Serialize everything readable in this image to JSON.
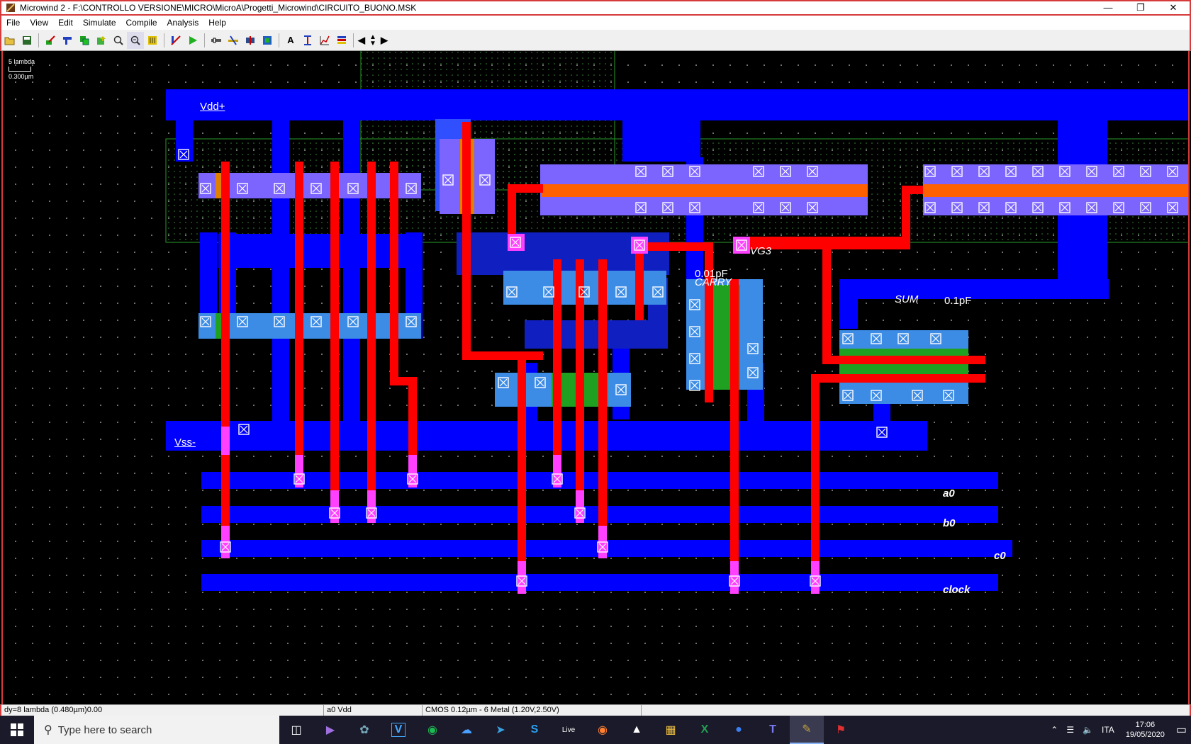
{
  "window": {
    "title": "Microwind 2 - F:\\CONTROLLO VERSIONE\\MICRO\\MicroA\\Progetti_Microwind\\CIRCUITO_BUONO.MSK"
  },
  "menu": [
    "File",
    "View",
    "Edit",
    "Simulate",
    "Compile",
    "Analysis",
    "Help"
  ],
  "toolbar": {
    "icons": [
      "open-icon",
      "save-icon",
      "draw-box-icon",
      "properties-icon",
      "duplicate-icon",
      "move-icon",
      "zoom-in-icon",
      "zoom-out-icon",
      "view-all-icon",
      "process-icon",
      "run-simulation-icon",
      "connect-icon",
      "cut-icon",
      "mos-generator-icon",
      "compile-icon",
      "text-icon",
      "vertical-stretch-icon",
      "graph-icon",
      "layers-icon",
      "arrow-left-icon",
      "arrow-up-down-icon",
      "arrow-right-icon"
    ],
    "text_button": "A"
  },
  "scale": {
    "lambda": "5 lambda",
    "micron": "0.300µm"
  },
  "labels": {
    "vdd": "Vdd+",
    "vss": "Vss-",
    "vg3": "VG3",
    "carry": "CARRY",
    "cap1": "0.01pF",
    "sum": "SUM",
    "cap2": "0.1pF",
    "a0": "a0",
    "b0": "b0",
    "c0": "c0",
    "clock": "clock"
  },
  "colors": {
    "metal1": "#0000ff",
    "diffusion": "#3c8ce6",
    "pdiff": "#7c64ff",
    "poly": "#ff0000",
    "contact_poly": "#ff40ff",
    "nwell": "#1a9a1a",
    "titlebar_border": "#d63a3a"
  },
  "status": {
    "coords": "dy=8 lambda (0.480µm)0.00",
    "node": "a0 Vdd",
    "process": "CMOS 0.12µm - 6 Metal (1.20V,2.50V)"
  },
  "taskbar": {
    "search_placeholder": "Type here to search",
    "apps": [
      "task-view-icon",
      "visual-studio-icon",
      "davinci-icon",
      "vivado-icon",
      "spotify-icon",
      "onedrive-icon",
      "telegram-icon",
      "skype-icon",
      "livestream-icon",
      "firefox-icon",
      "inkscape-icon",
      "file-explorer-icon",
      "excel-icon",
      "maps-icon",
      "teams-icon",
      "microwind-icon",
      "dsch-icon"
    ],
    "language": "ITA",
    "time": "17:06",
    "date": "19/05/2020"
  }
}
